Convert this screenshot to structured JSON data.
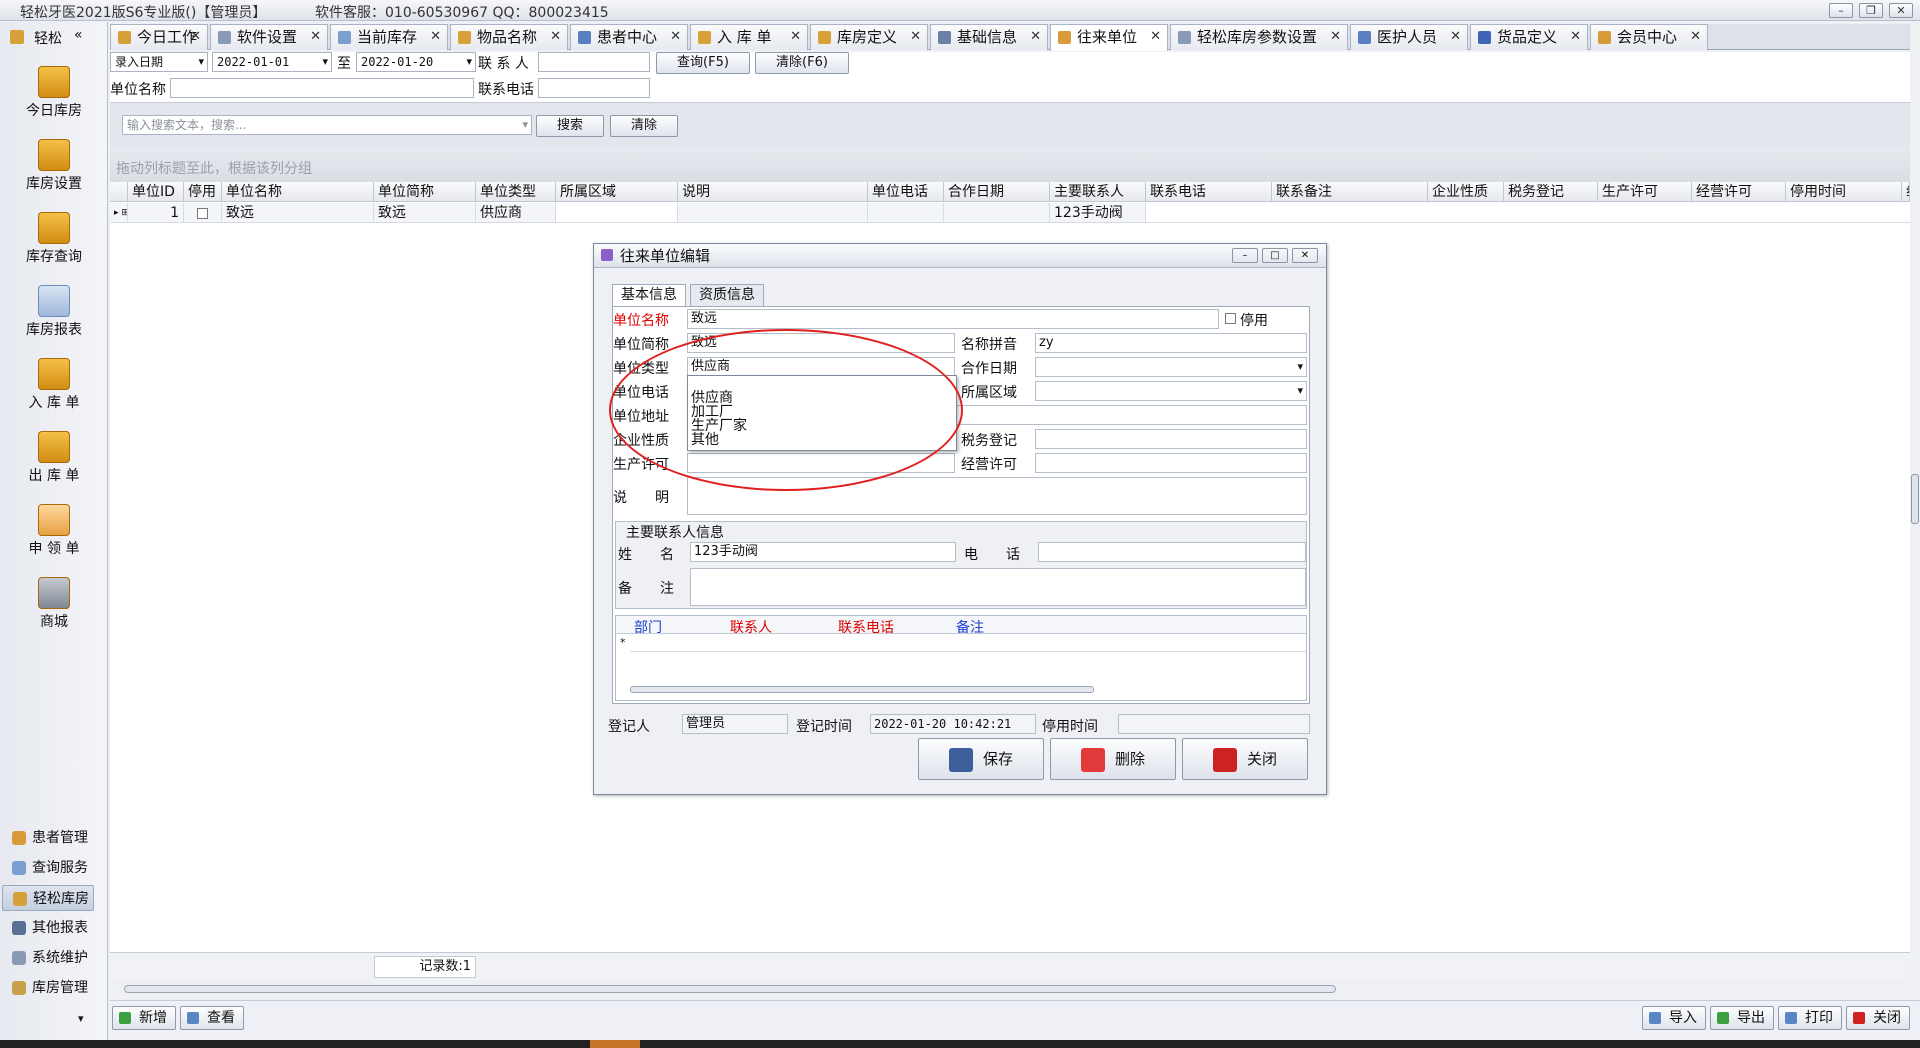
{
  "window": {
    "title": "轻松牙医2021版S6专业版()【管理员】",
    "support": "软件客服：010-60530967 QQ：800023415"
  },
  "nav": {
    "header": "轻松",
    "collapse": "«",
    "items": [
      {
        "label": "今日库房",
        "icon": "box-icon"
      },
      {
        "label": "库房设置",
        "icon": "gear-box-icon"
      },
      {
        "label": "库存查询",
        "icon": "boxes-icon"
      },
      {
        "label": "库房报表",
        "icon": "report-icon"
      },
      {
        "label": "入 库 单",
        "icon": "inbox-icon"
      },
      {
        "label": "出 库 单",
        "icon": "outbox-icon"
      },
      {
        "label": "申 领 单",
        "icon": "hand-icon"
      },
      {
        "label": "商城",
        "icon": "cart-icon"
      }
    ],
    "modules": [
      {
        "label": "患者管理"
      },
      {
        "label": "查询服务"
      },
      {
        "label": "轻松库房",
        "selected": true
      },
      {
        "label": "其他报表"
      },
      {
        "label": "系统维护"
      },
      {
        "label": "库房管理"
      }
    ]
  },
  "tabs": [
    {
      "label": "今日工作"
    },
    {
      "label": "软件设置"
    },
    {
      "label": "当前库存"
    },
    {
      "label": "物品名称"
    },
    {
      "label": "患者中心"
    },
    {
      "label": "入 库 单"
    },
    {
      "label": "库房定义"
    },
    {
      "label": "基础信息"
    },
    {
      "label": "往来单位",
      "active": true
    },
    {
      "label": "轻松库房参数设置"
    },
    {
      "label": "医护人员"
    },
    {
      "label": "货品定义"
    },
    {
      "label": "会员中心"
    }
  ],
  "filter": {
    "date_type": "录入日期",
    "date_from": "2022-01-01",
    "to_label": "至",
    "date_to": "2022-01-20",
    "contact_label": "联 系 人",
    "query_btn": "查询(F5)",
    "clear_btn": "清除(F6)",
    "unit_label": "单位名称",
    "phone_label": "联系电话"
  },
  "search": {
    "placeholder": "输入搜索文本，搜索...",
    "search_btn": "搜索",
    "clear_btn": "清除"
  },
  "group_hint": "拖动列标题至此，根据该列分组",
  "grid": {
    "columns": [
      "单位ID",
      "停用",
      "单位名称",
      "单位简称",
      "单位类型",
      "所属区域",
      "说明",
      "单位电话",
      "合作日期",
      "主要联系人",
      "联系电话",
      "联系备注",
      "企业性质",
      "税务登记",
      "生产许可",
      "经营许可",
      "停用时间",
      "组"
    ],
    "rows": [
      {
        "id": "1",
        "disabled": "",
        "name": "致远",
        "short": "致远",
        "type": "供应商",
        "contact": "123手动阀"
      }
    ]
  },
  "footer": {
    "record_count": "记录数:1"
  },
  "bottom": {
    "add": "新增",
    "view": "查看",
    "import": "导入",
    "export": "导出",
    "print": "打印",
    "close": "关闭"
  },
  "dialog": {
    "title": "往来单位编辑",
    "tab_basic": "基本信息",
    "tab_qual": "资质信息",
    "unit_name_label": "单位名称",
    "unit_name": "致远",
    "disabled_label": "停用",
    "short_label": "单位简称",
    "short": "致远",
    "pinyin_label": "名称拼音",
    "pinyin": "zy",
    "type_label": "单位类型",
    "type": "供应商",
    "coop_label": "合作日期",
    "phone_label": "单位电话",
    "region_label": "所属区域",
    "address_label": "单位地址",
    "nature_label": "企业性质",
    "tax_label": "税务登记",
    "prod_label": "生产许可",
    "biz_label": "经营许可",
    "note_label": "说　　明",
    "contact_group": "主要联系人信息",
    "name_label": "姓　　名",
    "contact_name": "123手动阀",
    "tel_label": "电　　话",
    "remark_label": "备　　注",
    "subgrid": [
      "部门",
      "联系人",
      "联系电话",
      "备注"
    ],
    "new_row_marker": "*",
    "registrar_label": "登记人",
    "registrar": "管理员",
    "reg_time_label": "登记时间",
    "reg_time": "2022-01-20 10:42:21",
    "stop_time_label": "停用时间",
    "save": "保存",
    "delete": "删除",
    "close": "关闭",
    "dropdown_options": [
      "供应商",
      "加工厂",
      "生产厂家",
      "其他"
    ]
  }
}
